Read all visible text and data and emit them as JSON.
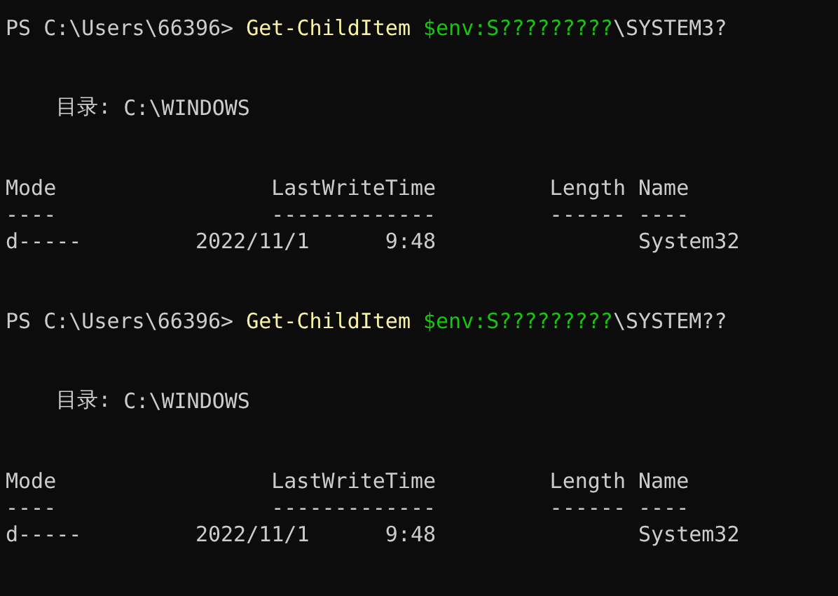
{
  "blocks": [
    {
      "prompt": "PS C:\\Users\\66396>",
      "command": "Get-ChildItem",
      "argument": "$env:S?????????",
      "rest": "\\SYSTEM3?",
      "listing": {
        "label": "目录:",
        "path": "C:\\WINDOWS",
        "columns": [
          "Mode",
          "LastWriteTime",
          "Length",
          "Name"
        ],
        "separators": [
          "----",
          "-------------",
          "------",
          "----"
        ],
        "rows": [
          {
            "mode": "d-----",
            "date": "2022/11/1",
            "time": "9:48",
            "name": "System32"
          }
        ]
      }
    },
    {
      "prompt": "PS C:\\Users\\66396>",
      "command": "Get-ChildItem",
      "argument": "$env:S?????????",
      "rest": "\\SYSTEM??",
      "listing": {
        "label": "目录:",
        "path": "C:\\WINDOWS",
        "columns": [
          "Mode",
          "LastWriteTime",
          "Length",
          "Name"
        ],
        "separators": [
          "----",
          "-------------",
          "------",
          "----"
        ],
        "rows": [
          {
            "mode": "d-----",
            "date": "2022/11/1",
            "time": "9:48",
            "name": "System32"
          }
        ]
      }
    }
  ]
}
